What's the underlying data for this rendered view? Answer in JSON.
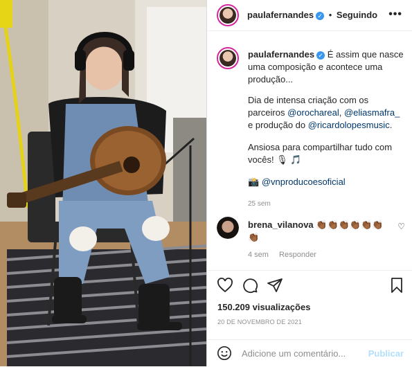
{
  "header": {
    "username": "paulafernandes",
    "separator": "•",
    "follow_status": "Seguindo",
    "more_icon": "more-horizontal-icon"
  },
  "caption": {
    "username": "paulafernandes",
    "line1": "É assim que nasce uma composição e acontece uma produção...",
    "line2_pre": "Dia de intensa criação com os parceiros ",
    "mention1": "@orochareal",
    "comma": ", ",
    "mention2": "@eliasmafra_",
    "line2_mid": " e produção do ",
    "mention3": "@ricardolopesmusic",
    "line2_end": ".",
    "line3": "Ansiosa para compartilhar tudo com vocês! 🎙 🎵",
    "line4_icon": "📸",
    "mention4": "@vnproducoesoficial",
    "time": "25 sem"
  },
  "comment": {
    "username": "brena_vilanova",
    "text": "👏🏾👏🏾👏🏾👏🏾👏🏾👏🏾👏🏾",
    "time": "4 sem",
    "reply": "Responder"
  },
  "stats": {
    "views": "150.209 visualizações",
    "date": "20 DE NOVEMBRO DE 2021"
  },
  "composer": {
    "placeholder": "Adicione um comentário...",
    "publish": "Publicar"
  },
  "colors": {
    "link": "#00376b",
    "verified": "#3897f0",
    "muted": "#8e8e8e",
    "publish_disabled": "#b2dffc"
  }
}
